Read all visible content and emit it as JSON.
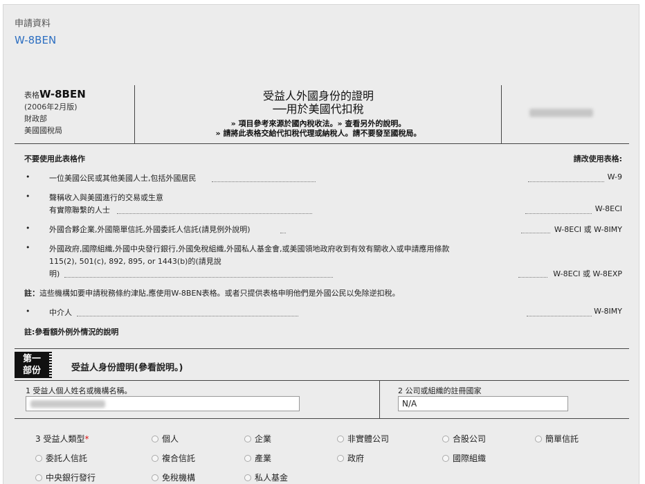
{
  "page": {
    "section_label": "申請資料",
    "form_link": "W-8BEN"
  },
  "form_header": {
    "form_prefix": "表格",
    "form_code": "W-8BEN",
    "revision": "(2006年2月版)",
    "dept": "財政部",
    "agency": "美國國稅局",
    "title_line1": "受益人外國身份的證明",
    "title_line2": "──用於美國代扣稅",
    "note1": "» 項目參考來源於國內稅收法。» 查看另外的說明。",
    "note2": "» 請將此表格交給代扣稅代理或納稅人。請不要發至國稅局。"
  },
  "usage": {
    "left_heading": "不要使用此表格作",
    "right_heading": "請改使用表格:",
    "bullet": "•",
    "rows": [
      {
        "text": "一位美國公民或其他美國人士,包括外國居民",
        "form": "W-9"
      },
      {
        "text_line1": "聲稱收入與美國進行的交易或生意",
        "text_line2": "有實際聯繫的人士",
        "form": "W-8ECI"
      },
      {
        "text": "外國合夥企業,外國簡單信託,外國委託人信託(請見例外說明)",
        "form": "W-8ECI 或 W-8IMY"
      },
      {
        "text_line1": "外國政府,國際組織,外國中央發行銀行,外國免稅組織,外國私人基金會,或美國領地政府收到有效有關收入或申請應用條款",
        "text_line2": "115(2), 501(c), 892, 895, or 1443(b)的(請見說",
        "text_line3": "明)",
        "form": "W-8ECI 或 W-8EXP"
      }
    ],
    "note_label": "註：",
    "note_text": "這些機構如要申請稅務條約津貼,應使用W-8BEN表格。或者只提供表格申明他們是外國公民以免除逆扣稅。",
    "intermediary": {
      "text": "中介人",
      "form": "W-8IMY"
    },
    "footnote": "註:參看額外例外情況的說明"
  },
  "part1": {
    "badge_line1": "第一",
    "badge_line2": "部份",
    "title": "受益人身份證明(參看說明。)",
    "field1_label": "1 受益人個人姓名或機構名稱。",
    "field2_label": "2 公司或組織的註冊國家",
    "field2_value": "N/A",
    "field3_label": "3 受益人類型",
    "required_mark": "*",
    "types": [
      "個人",
      "企業",
      "非實體公司",
      "合股公司",
      "簡單信託",
      "委託人信託",
      "複合信託",
      "產業",
      "政府",
      "國際組織",
      "中央銀行發行",
      "免稅機構",
      "私人基金"
    ]
  }
}
